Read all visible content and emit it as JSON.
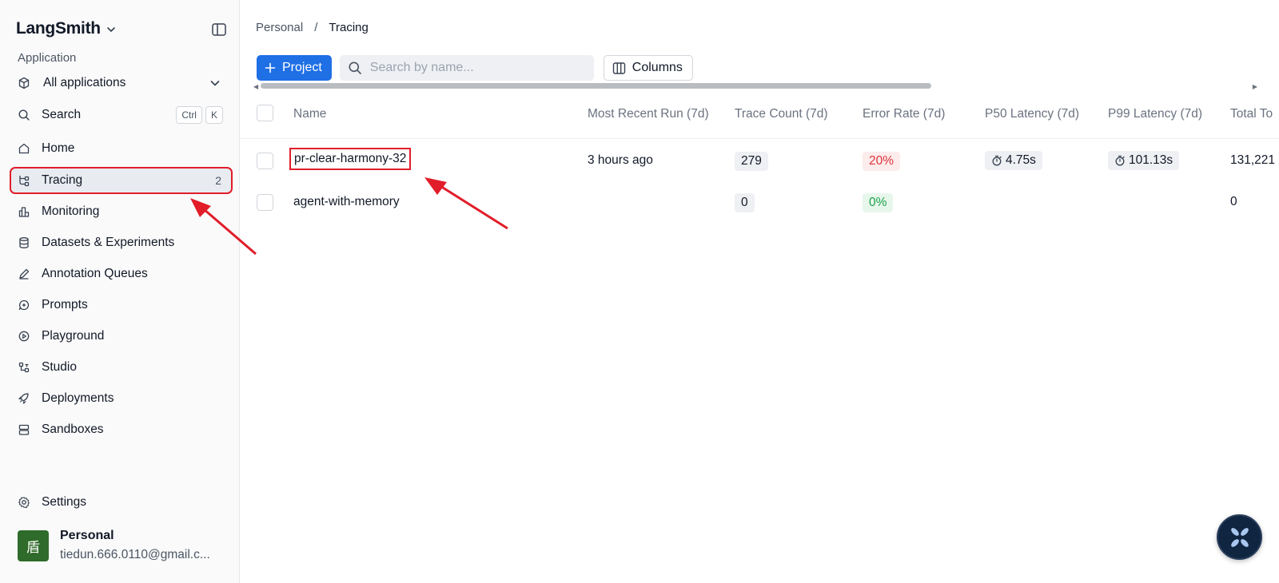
{
  "sidebar": {
    "brand": "LangSmith",
    "section_label": "Application",
    "app_select": "All applications",
    "search": {
      "label": "Search",
      "kbd": [
        "Ctrl",
        "K"
      ]
    },
    "items": [
      {
        "label": "Home"
      },
      {
        "label": "Tracing",
        "count": "2"
      },
      {
        "label": "Monitoring"
      },
      {
        "label": "Datasets & Experiments"
      },
      {
        "label": "Annotation Queues"
      },
      {
        "label": "Prompts"
      },
      {
        "label": "Playground"
      },
      {
        "label": "Studio"
      },
      {
        "label": "Deployments"
      },
      {
        "label": "Sandboxes"
      }
    ],
    "settings": "Settings",
    "user": {
      "avatar": "盾",
      "name": "Personal",
      "email": "tiedun.666.0110@gmail.c..."
    }
  },
  "breadcrumb": {
    "root": "Personal",
    "separator": "/",
    "current": "Tracing"
  },
  "toolbar": {
    "project_button": "Project",
    "search_placeholder": "Search by name...",
    "columns_button": "Columns"
  },
  "table": {
    "headers": [
      "Name",
      "Most Recent Run (7d)",
      "Trace Count (7d)",
      "Error Rate (7d)",
      "P50 Latency (7d)",
      "P99 Latency (7d)",
      "Total To"
    ],
    "rows": [
      {
        "name": "pr-clear-harmony-32",
        "recent": "3 hours ago",
        "trace_count": "279",
        "error_rate": "20%",
        "p50": "4.75s",
        "p99": "101.13s",
        "total": "131,221"
      },
      {
        "name": "agent-with-memory",
        "recent": "",
        "trace_count": "0",
        "error_rate": "0%",
        "p50": "",
        "p99": "",
        "total": "0"
      }
    ]
  },
  "colors": {
    "accent": "#1f6fe5",
    "highlight": "#e11d2a",
    "error": "#e0323a",
    "success": "#18a34a"
  }
}
